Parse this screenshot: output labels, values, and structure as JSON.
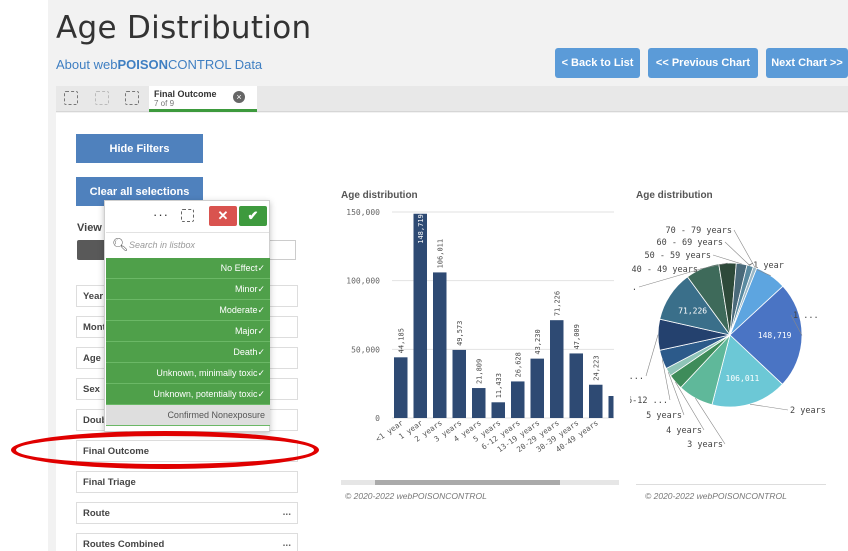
{
  "page": {
    "title": "Age Distribution",
    "subtitle_pre": "About web",
    "subtitle_bold": "POISON",
    "subtitle_post": "CONTROL Data"
  },
  "nav": {
    "back": "< Back to List",
    "previous": "<< Previous Chart",
    "next": "Next Chart >>"
  },
  "selection_tab": {
    "field": "Final Outcome",
    "count": "7 of 9"
  },
  "buttons": {
    "hide_filters": "Hide Filters",
    "clear_all": "Clear all selections"
  },
  "view_label": "View c",
  "listbox": {
    "search_placeholder": "Search in listbox",
    "options": [
      {
        "label": "No Effect",
        "state": "selected"
      },
      {
        "label": "Minor",
        "state": "selected"
      },
      {
        "label": "Moderate",
        "state": "selected"
      },
      {
        "label": "Major",
        "state": "selected"
      },
      {
        "label": "Death",
        "state": "selected"
      },
      {
        "label": "Unknown, minimally toxic",
        "state": "selected"
      },
      {
        "label": "Unknown, potentially toxic",
        "state": "selected"
      },
      {
        "label": "Confirmed Nonexposure",
        "state": "excluded"
      }
    ]
  },
  "filters": [
    {
      "label": "Year",
      "more": ""
    },
    {
      "label": "Mont",
      "more": ""
    },
    {
      "label": "Age G",
      "more": ""
    },
    {
      "label": "Sex",
      "more": ""
    },
    {
      "label": "Doub",
      "more": ""
    },
    {
      "label": "Final Outcome",
      "more": ""
    },
    {
      "label": "Final Triage",
      "more": ""
    },
    {
      "label": "Route",
      "more": "..."
    },
    {
      "label": "Routes Combined",
      "more": "..."
    }
  ],
  "charts": {
    "bar_title": "Age distribution",
    "pie_title": "Age distribution",
    "footer": "© 2020-2022 webPOISONCONTROL"
  },
  "colors": {
    "bar": "#2e4a73",
    "accent": "#5b9bd8",
    "selected": "#4fa04a",
    "highlight": "#e00000"
  },
  "chart_data": [
    {
      "type": "bar",
      "title": "Age distribution",
      "categories": [
        "<1 year",
        "1 year",
        "2 years",
        "3 years",
        "4 years",
        "5 years",
        "6-12 years",
        "13-19 years",
        "20-29 years",
        "30-39 years",
        "40-49 years"
      ],
      "values": [
        44185,
        148719,
        106011,
        49573,
        21809,
        11433,
        26628,
        43230,
        71226,
        47009,
        24223
      ],
      "ylim": [
        0,
        150000
      ],
      "yticks": [
        "0",
        "50,000",
        "100,000",
        "150,000"
      ],
      "value_labels": [
        "44,185",
        "148,719",
        "106,011",
        "49,573",
        "21,809",
        "11,433",
        "26,628",
        "43,230",
        "71,226",
        "47,009",
        "24,223"
      ]
    },
    {
      "type": "pie",
      "title": "Age distribution",
      "slices": [
        {
          "label": "<1 year",
          "value": 44185,
          "color": "#5da5e0",
          "text": ""
        },
        {
          "label": "1 ...",
          "value": 148719,
          "color": "#4a74c4",
          "text": "148,719"
        },
        {
          "label": "2 years",
          "value": 106011,
          "color": "#6cc8d6",
          "text": "106,011"
        },
        {
          "label": "3 years",
          "value": 49573,
          "color": "#5fb89a",
          "text": ""
        },
        {
          "label": "4 years",
          "value": 21809,
          "color": "#3e8c5a",
          "text": ""
        },
        {
          "label": "5 years",
          "value": 11433,
          "color": "#8fc4b8",
          "text": ""
        },
        {
          "label": "6-12 ...",
          "value": 26628,
          "color": "#2c5a8a",
          "text": ""
        },
        {
          "label": "1...",
          "value": 43230,
          "color": "#24416e",
          "text": ""
        },
        {
          "label": "",
          "value": 71226,
          "color": "#3a6f8a",
          "text": "71,226"
        },
        {
          "label": "30 - 3...",
          "value": 47009,
          "color": "#3e6a5a",
          "text": ""
        },
        {
          "label": "40 - 49 years",
          "value": 24223,
          "color": "#2e4a3a",
          "text": ""
        },
        {
          "label": "50 - 59 years",
          "value": 15000,
          "color": "#4a6a7a",
          "text": ""
        },
        {
          "label": "60 - 69 years",
          "value": 9000,
          "color": "#5a8aa0",
          "text": ""
        },
        {
          "label": "70 - 79 years",
          "value": 5000,
          "color": "#9ab8c8",
          "text": ""
        }
      ]
    }
  ]
}
